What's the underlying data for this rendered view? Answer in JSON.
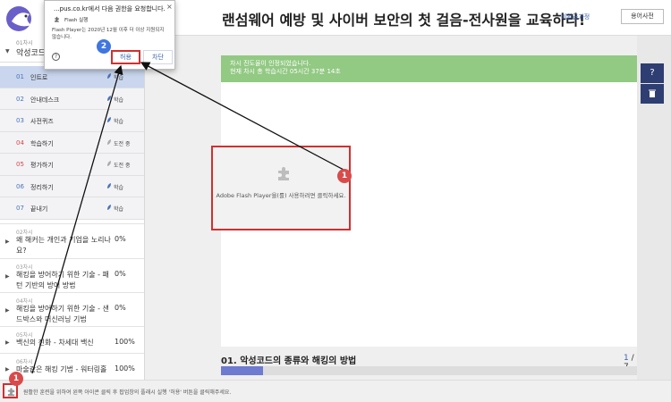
{
  "sidebar": {
    "chapter_head": {
      "num": "01차시",
      "title": "악성코드의 종류와 해킹의 방법"
    },
    "lessons": [
      {
        "no": "01",
        "name": "인트로",
        "status": "학습",
        "active": true,
        "color": "blue"
      },
      {
        "no": "02",
        "name": "안내데스크",
        "status": "학습",
        "active": false,
        "color": "blue"
      },
      {
        "no": "03",
        "name": "사전퀴즈",
        "status": "학습",
        "active": false,
        "color": "blue"
      },
      {
        "no": "04",
        "name": "학습하기",
        "status": "도전 중",
        "active": false,
        "color": "red"
      },
      {
        "no": "05",
        "name": "평가하기",
        "status": "도전 중",
        "active": false,
        "color": "red"
      },
      {
        "no": "06",
        "name": "정리하기",
        "status": "학습",
        "active": false,
        "color": "blue"
      },
      {
        "no": "07",
        "name": "끝내기",
        "status": "학습",
        "active": false,
        "color": "blue"
      }
    ],
    "chapters": [
      {
        "num": "02차시",
        "title": "왜 해커는 개인과 기업을 노리나요?",
        "pct": "0%"
      },
      {
        "num": "03차시",
        "title": "해킹을 방어하기 위한 기술 - 패턴 기반의 방어 방법",
        "pct": "0%"
      },
      {
        "num": "04차시",
        "title": "해킹을 방어하기 위한 기술 - 샌드박스와 머신러닝 기법",
        "pct": "0%"
      },
      {
        "num": "05차시",
        "title": "백신의 진화 - 차세대 백신",
        "pct": "100%"
      },
      {
        "num": "06차시",
        "title": "마술같은 해킹 기법 - 워터링홀",
        "pct": "100%"
      }
    ]
  },
  "header": {
    "title": "랜섬웨어 예방 및 사이버 보안의 첫 걸음-전사원을 교육하라!",
    "course_type": "비환급과정",
    "dict_button": "용어사전"
  },
  "notice": {
    "line1": "차시 진도율이 인정되었습니다.",
    "line2": "현재 차시 총 학습시간 05시간 37분 14초"
  },
  "player": {
    "message": "Adobe Flash Player을(를) 사용하려면 클릭하세요."
  },
  "lesson_bar": {
    "title": "01. 악성코드의 종류와 해킹의 방법",
    "page_current": "1",
    "page_total": " / 7",
    "progress": 0.1
  },
  "popup": {
    "title": "...pus.co.kr에서 다음 권한을 요청합니다.",
    "close": "×",
    "flash_label": "Flash 실행",
    "desc": "Flash Player는 2020년 12월 이후 더 이상 지원되지 않습니다.",
    "help": "?",
    "allow": "허용",
    "block": "차단"
  },
  "bottom": {
    "text": "원활한 훈련을 위하여 왼쪽 아이콘 클릭 후 팝업창의 플래시 실행 '허용' 버튼을 클릭해주세요."
  },
  "badges": {
    "one": "1",
    "two": "2"
  },
  "colors": {
    "accent": "#3a62b0",
    "notice": "#92c983",
    "highlight": "#d32f2f",
    "navy": "#2e3e72"
  }
}
